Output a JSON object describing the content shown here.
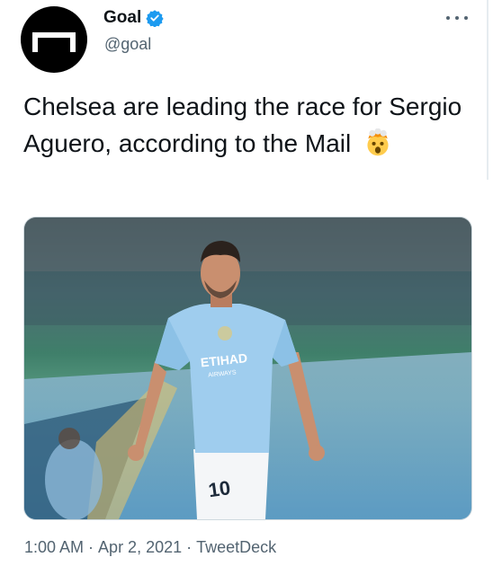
{
  "author": {
    "display_name": "Goal",
    "handle": "@goal",
    "verified": true,
    "avatar_icon": "goal-frame-logo"
  },
  "menu_icon": "more-options-icon",
  "tweet": {
    "text": "Chelsea are leading the race for Sergio Aguero, according to the Mail",
    "emoji": "exploding-head-emoji"
  },
  "media": {
    "jersey_sponsor": "ETIHAD",
    "jersey_sponsor_sub": "AIRWAYS",
    "shirt_number": "10"
  },
  "meta": {
    "time": "1:00 AM",
    "separator": "·",
    "date": "Apr 2, 2021",
    "source": "TweetDeck"
  },
  "colors": {
    "text": "#0f1419",
    "secondary": "#536471",
    "verified": "#1d9bf0",
    "jersey": "#9fcdee"
  }
}
